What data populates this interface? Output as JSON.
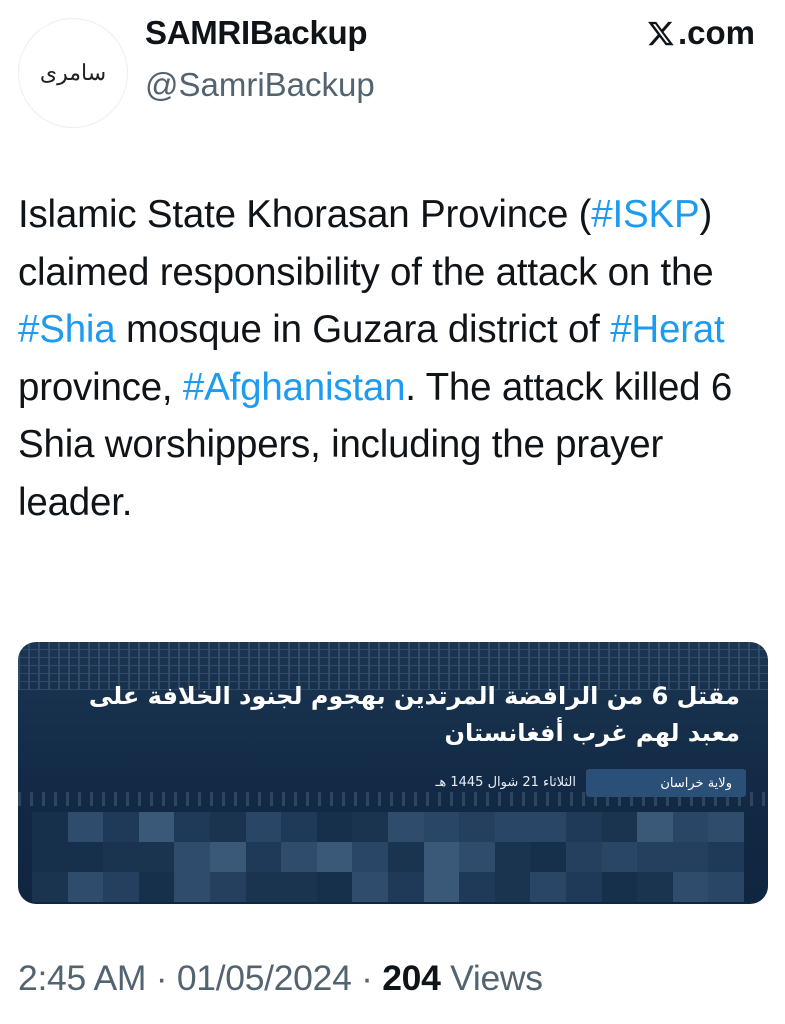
{
  "author": {
    "avatar_text": "سامری",
    "display_name": "SAMRIBackup",
    "handle": "@SamriBackup"
  },
  "brand": {
    "logo_icon": "x-logo-icon",
    "label": ".com"
  },
  "tweet": {
    "segments": [
      {
        "text": "Islamic State Khorasan Province (",
        "tag": false
      },
      {
        "text": "#ISKP",
        "tag": true
      },
      {
        "text": ") claimed responsibility of the attack on the ",
        "tag": false
      },
      {
        "text": "#Shia",
        "tag": true
      },
      {
        "text": " mosque in Guzara district of ",
        "tag": false
      },
      {
        "text": "#Herat",
        "tag": true
      },
      {
        "text": " province, ",
        "tag": false
      },
      {
        "text": "#Afghanistan",
        "tag": true
      },
      {
        "text": ". The attack killed 6 Shia worshippers, including the prayer leader.",
        "tag": false
      }
    ]
  },
  "media": {
    "headline_line1": "مقتل 6 من الرافضة المرتدين بهجوم لجنود الخلافة على",
    "headline_line2": "معبد لهم غرب أفغانستان",
    "date": "الثلاثاء 21 شوال 1445 هـ",
    "province": "ولاية خراسان",
    "body_pixelated": true
  },
  "footer": {
    "time": "2:45 AM",
    "separator": "·",
    "date": "01/05/2024",
    "views_count": "204",
    "views_label": "Views"
  },
  "colors": {
    "hashtag": "#1d9bf0",
    "secondary_text": "#536471",
    "primary_text": "#0f1419",
    "media_bg": "#122a45"
  }
}
